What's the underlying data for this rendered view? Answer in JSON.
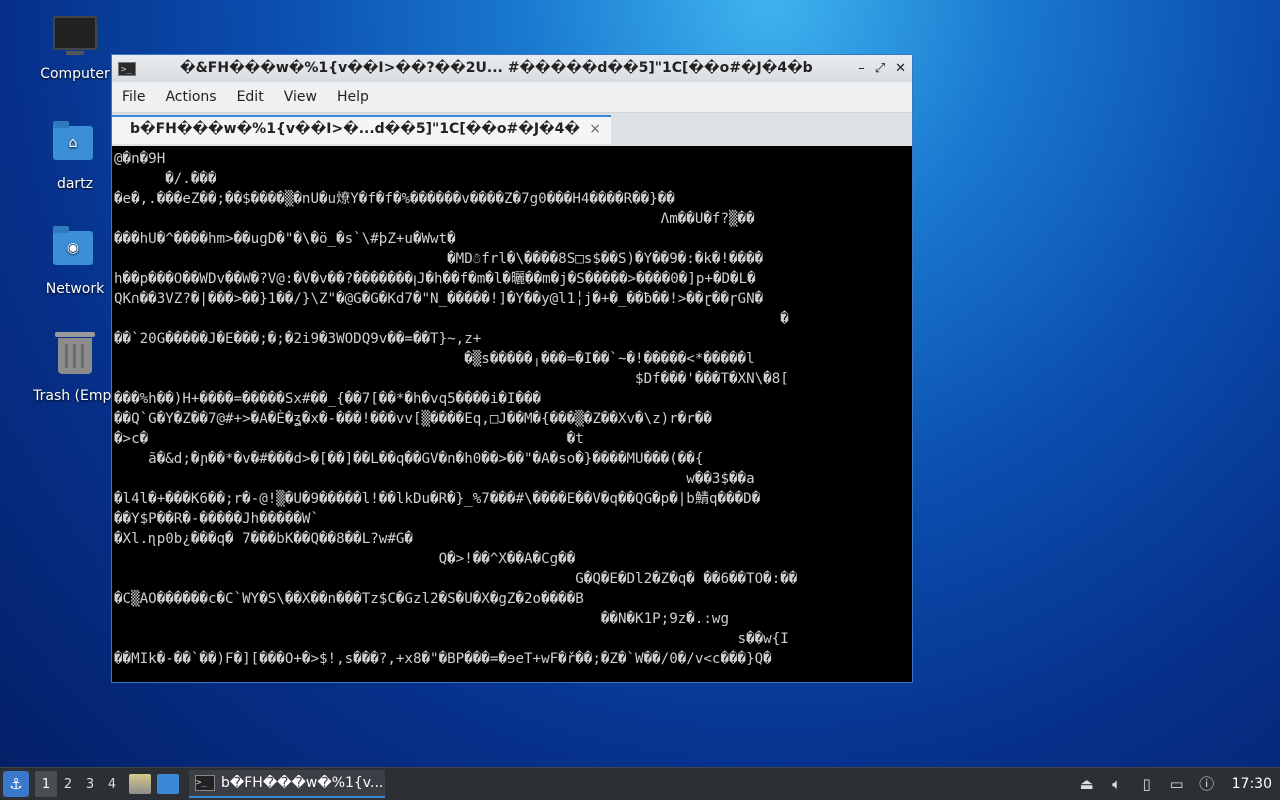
{
  "desktop": {
    "icons": [
      {
        "label": "Computer"
      },
      {
        "label": "dartz"
      },
      {
        "label": "Network"
      },
      {
        "label": "Trash (Empt"
      }
    ]
  },
  "window": {
    "title": "�&FH���w�%1{v��I>��?��2U...   #�����d��5]\"1C[��o#�J�4�b",
    "menu": [
      "File",
      "Actions",
      "Edit",
      "View",
      "Help"
    ],
    "tab_label": "b�FH���w�%1{v��I>�...d��5]\"1C[��o#�J�4�",
    "tab_close": "×",
    "controls": {
      "minimize": "–",
      "maximize": "⤢",
      "close": "✕"
    }
  },
  "terminal": {
    "lines": [
      "@�n�9H",
      "      �/.���",
      "�e�,.���eZ��;��$����▒�nU�u燎Y�f�f�%������v����Z�7g0���H4����R��}��",
      "                                                                Λm��U�f?▒��",
      "���hU�^����hm>��ugD�\"�\\�ö_�s`\\#þZ+u�Wwt�",
      "                                       �MD☃frl�\\����8S□s$��S)�Y��9�:�k�!����",
      "h��p���O��WDv��W�?V@:�V�v��?�������ꞁJ�h��f�m�l�曬��m�j�S�����>����0�]p+�D�L�",
      "QK∩��3VZ?�|���>��}1��/}\\Z\"�@G�G�Kd7�\"N_�����!]�Y��y@l1╎j�+�_��ƀ��!>��ɽ��ɼGN�",
      "                                                                              �",
      "��`20G�����J�E���;�;�2i9�3WODQ9v��=��T}~,z+",
      "                                         �▒s�����╷���=�I��`~�!�����<*�����l",
      "                                                             $Df���'���T�XN\\�8[",
      "���%h��)H+����=�����Sx#��_{��7[��*�h�vq5����i�I���",
      "��Q`G�Y�Z��7@#+>�A�È�ʓ�x�-���!���vv[▒����Eq,□J��M�{���▒�Z��Xv�\\z)r�r��",
      "�>c�                                                 �t",
      "    ã�&d;�ɲ��*�v�#���d>�[��]��L��q��GV�n�h0��>��\"�A�so�}����MU���(��{",
      "                                                                   w��3$��a",
      "�l4l�+���K6��;r�-@!▒�U�9�����l!��lkDu�R�}_%7���#\\����E��V�q��QG�p�|b鯖q���D�",
      "��Y$P��R�-�����Jh�����W`",
      "�Xl.ɳp0b¿���q� 7���bK��Q��8��L?w#G�",
      "                                      Q�>!��^X��A�Cg��",
      "                                                      G�Q�E�Dl2�Z�q� ��6��TO�:��",
      "�C▒AO������c�C`WY�S\\��X��n���Tz$C�Gzl2�S�U�X�gZ�2o����B",
      "                                                         ��N�K1P;9z�.:wg",
      "                                                                         s��w{I",
      "��MIk�-��`��)F�][���O+�>$!,s���?,+x8�\"�BP���=�ɘeT+wF�ř��;�Z�`W��/0�/v<c���}Q�"
    ]
  },
  "taskbar": {
    "workspaces": [
      "1",
      "2",
      "3",
      "4"
    ],
    "task_label": "b�FH���w�%1{v...",
    "clock": "17:30"
  }
}
